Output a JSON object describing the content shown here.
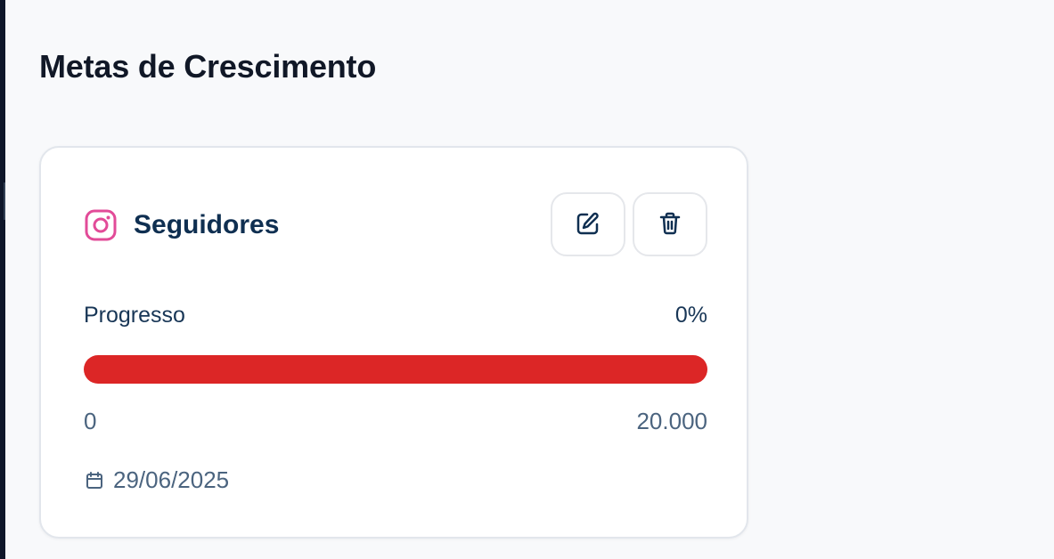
{
  "page": {
    "title": "Metas de Crescimento"
  },
  "goal": {
    "platform_icon": "instagram-icon",
    "title": "Seguidores",
    "actions": {
      "edit_icon": "edit-icon",
      "delete_icon": "trash-icon"
    },
    "progress": {
      "label": "Progresso",
      "percent_text": "0%",
      "value": 0
    },
    "range": {
      "start": "0",
      "end": "20.000"
    },
    "date_icon": "calendar-icon",
    "date": "29/06/2025"
  },
  "colors": {
    "instagram_accent": "#e24b98",
    "progress_bar": "#dc2626",
    "title_text": "#111827",
    "card_title": "#0f2f51"
  }
}
